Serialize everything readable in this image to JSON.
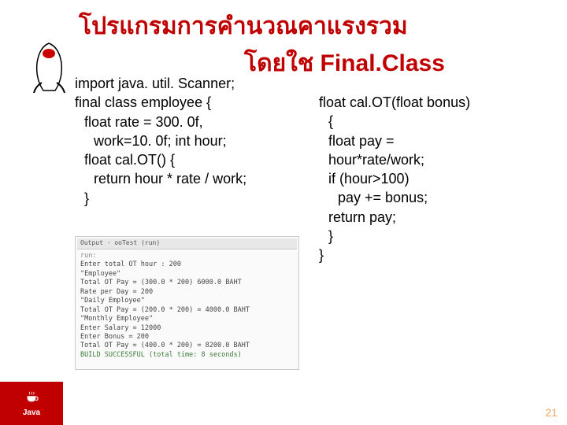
{
  "title": {
    "line1": "โปรแกรมการคำนวณคาแรงรวม",
    "line2": "โดยใช   Final.Class"
  },
  "code_left": {
    "l1": "import java. util. Scanner;",
    "l2": "final class employee {",
    "l3": "float rate = 300. 0f,",
    "l4": "work=10. 0f; int hour;",
    "l5": "float cal.OT() {",
    "l6": "return hour * rate / work;",
    "l7": "}"
  },
  "code_right": {
    "l1": "float cal.OT(float bonus)",
    "l2": "{",
    "l3": "float pay =",
    "l4": "hour*rate/work;",
    "l5": "if (hour>100)",
    "l6": "pay += bonus;",
    "l7": "return pay;",
    "l8": "}",
    "l9": "}"
  },
  "screenshot": {
    "tab": "Output - ooTest (run)",
    "lines": [
      "run:",
      "Enter total OT hour : 200",
      "\"Employee\"",
      "Total OT Pay = (300.0 * 200)  6000.0 BAHT",
      "Rate per Day = 200",
      "\"Daily Employee\"",
      "Total OT Pay = (200.0 * 200) = 4000.0 BAHT",
      "\"Monthly Employee\"",
      "Enter Salary = 12000",
      "Enter Bonus = 200",
      "Total OT Pay = (400.0 * 200) = 8200.0 BAHT",
      "BUILD SUCCESSFUL (total time: 8 seconds)"
    ]
  },
  "logo": {
    "text": "Java"
  },
  "page": "21"
}
